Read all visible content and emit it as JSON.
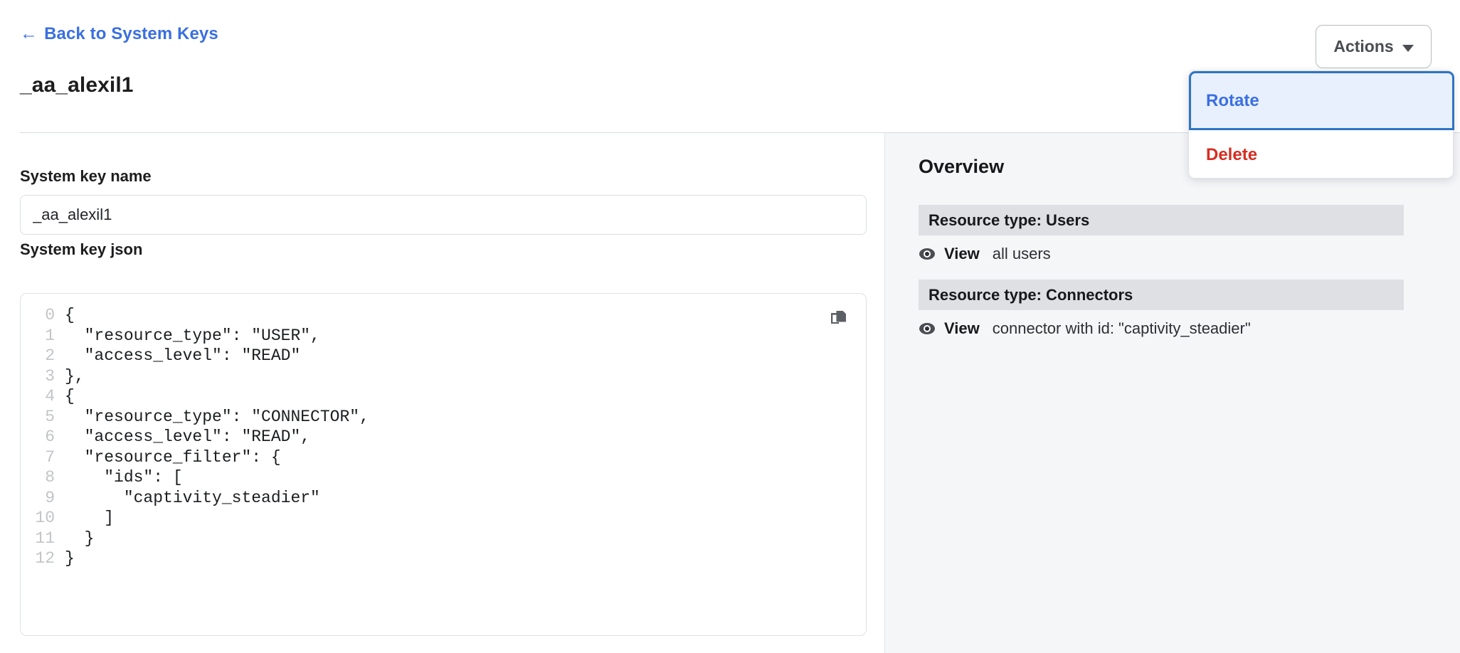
{
  "header": {
    "back_link_label": "Back to System Keys",
    "back_arrow_glyph": "←",
    "page_title": "_aa_alexil1",
    "actions_button_label": "Actions"
  },
  "dropdown": {
    "items": [
      {
        "label": "Rotate",
        "state": "highlighted",
        "color": "#3b6fe0"
      },
      {
        "label": "Delete",
        "state": "normal",
        "color": "#d62e21"
      }
    ]
  },
  "form": {
    "name_label": "System key name",
    "name_value": "_aa_alexil1",
    "name_placeholder": "System key name",
    "json_label": "System key json"
  },
  "code_block": {
    "copy_icon": "copy-icon",
    "lines": [
      {
        "n": "0",
        "text": "{"
      },
      {
        "n": "1",
        "text": "  \"resource_type\": \"USER\","
      },
      {
        "n": "2",
        "text": "  \"access_level\": \"READ\""
      },
      {
        "n": "3",
        "text": "},"
      },
      {
        "n": "4",
        "text": "{"
      },
      {
        "n": "5",
        "text": "  \"resource_type\": \"CONNECTOR\","
      },
      {
        "n": "6",
        "text": "  \"access_level\": \"READ\","
      },
      {
        "n": "7",
        "text": "  \"resource_filter\": {"
      },
      {
        "n": "8",
        "text": "    \"ids\": ["
      },
      {
        "n": "9",
        "text": "      \"captivity_steadier\""
      },
      {
        "n": "10",
        "text": "    ]"
      },
      {
        "n": "11",
        "text": "  }"
      },
      {
        "n": "12",
        "text": "}"
      }
    ]
  },
  "overview": {
    "title": "Overview",
    "sections": [
      {
        "bar_label": "Resource type: Users",
        "link_strong": "View",
        "link_rest": "all users",
        "icon": "eye-icon"
      },
      {
        "bar_label": "Resource type: Connectors",
        "link_strong": "View",
        "link_rest": "connector with id: \"captivity_steadier\"",
        "icon": "eye-icon"
      }
    ]
  },
  "colors": {
    "link_blue": "#3b6fe0",
    "danger_red": "#d62e21",
    "panel_bg": "#f5f6f8",
    "bar_bg": "#dfe0e3",
    "highlight_bg": "#e8f0fe",
    "highlight_border": "#2f73c4"
  }
}
